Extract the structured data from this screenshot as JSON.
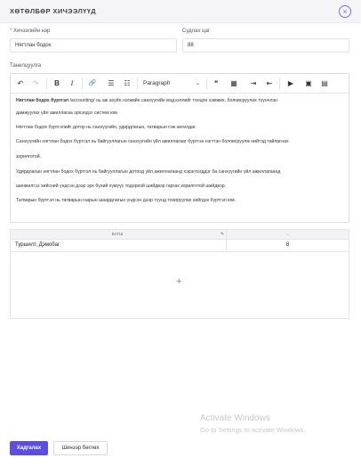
{
  "dialog": {
    "title": "ХӨТӨЛБӨР ХИЧЭЭЛҮҮД",
    "close_icon": "×"
  },
  "form": {
    "name_label": "Хичээлийн нэр",
    "name_required": "*",
    "name_value": "Нягтлан бодох",
    "hours_label": "Судлах цаг",
    "hours_value": "88",
    "intro_label": "Танилцуулга"
  },
  "toolbar": {
    "undo_icon": "↶",
    "redo_icon": "↷",
    "bold": "B",
    "italic": "I",
    "link_icon": "🔗",
    "bullets_icon": "☰",
    "numbered_icon": "☷",
    "paragraph": "Paragraph",
    "paragraph_chevron": "⌄",
    "quote_icon": "❝",
    "table_icon": "▦",
    "indent_in_icon": "⇥",
    "indent_out_icon": "⇤",
    "media_icon": "▶",
    "image_icon": "▣",
    "file_icon": "▤"
  },
  "content": {
    "p1_bold": "Нягтлан бодох бүртгэл",
    "p1_rest": " /accounting/ нь аж ахуйн нэгжийн санхүүгийн мэдээллийг тооцон хэмжих, боловсруулах түүнчлэн",
    "p1_line2": "дамжуулах үйл ажиллагаа эрхэлдэг систем юм.",
    "p2": "Нягтлан бодох бүртгэлийг дотор нь санхүүгийн, удирдлагын, татварын гэж ангилдаг.",
    "p3": "Санхүүгийн нягтлан бодох бүртгэл нь байгууллагын санхүүгийн үйл ажиллагааг бүртгэн нэгтгэн боловсруулж нийтэд тайлагнах",
    "p3_line2": "зорилготой.",
    "p4": "Удирдлагын нягтлан бодох бүртгэл нь байгууллагын дотоод үйл ажиллагаанд хэрэглэгддэг ба санхүүгийн үйл ажиллагаанд",
    "p4_line2": "шинжилгээ хийсний үндсэн дээр эрх бүхий хүмүүс тодорхой шийдвэр гаргах зорилготой шийдвэр.",
    "p5": "Татварын бүртгэл нь татварын газрын шаардлагын үндсэн дээр түүнд тохируулах хийгдэх бүртгэл юм."
  },
  "grid": {
    "col_teacher": "БАГШ",
    "col_second": "...",
    "row_teacher": "Туршилт, Дэмобаг",
    "row_value": "8",
    "add_icon": "+"
  },
  "watermark": {
    "line1": "Activate Windows",
    "line2": "Go to Settings to activate Windows."
  },
  "buttons": {
    "save": "Хадгалах",
    "clear": "Шинээр бөглөх"
  },
  "colors": {
    "accent": "#5b4ee8"
  }
}
